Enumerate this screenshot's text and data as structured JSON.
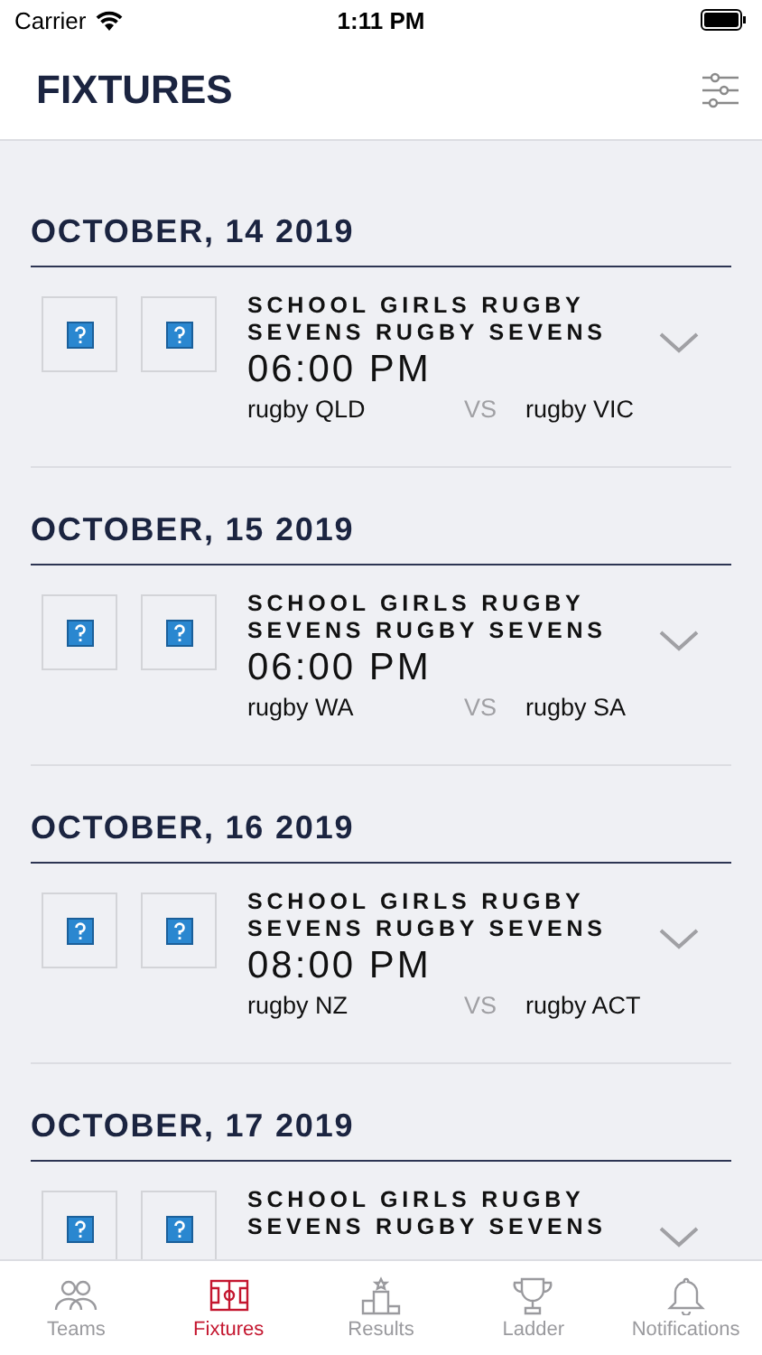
{
  "status_bar": {
    "carrier": "Carrier",
    "time": "1:11 PM"
  },
  "header": {
    "title": "FIXTURES"
  },
  "days": [
    {
      "date": "OCTOBER, 14 2019",
      "fixtures": [
        {
          "competition": "SCHOOL GIRLS RUGBY SEVENS RUGBY SEVENS",
          "time": "06:00 PM",
          "home": "rugby QLD",
          "vs": "VS",
          "away": "rugby VIC"
        }
      ]
    },
    {
      "date": "OCTOBER, 15 2019",
      "fixtures": [
        {
          "competition": "SCHOOL GIRLS RUGBY SEVENS RUGBY SEVENS",
          "time": "06:00 PM",
          "home": "rugby WA",
          "vs": "VS",
          "away": "rugby SA"
        }
      ]
    },
    {
      "date": "OCTOBER, 16 2019",
      "fixtures": [
        {
          "competition": "SCHOOL GIRLS RUGBY SEVENS RUGBY SEVENS",
          "time": "08:00 PM",
          "home": "rugby NZ",
          "vs": "VS",
          "away": "rugby ACT"
        }
      ]
    },
    {
      "date": "OCTOBER, 17 2019",
      "fixtures": [
        {
          "competition": "SCHOOL GIRLS RUGBY SEVENS RUGBY SEVENS"
        }
      ]
    }
  ],
  "tabs": [
    {
      "label": "Teams",
      "kind": "teams",
      "selected": false
    },
    {
      "label": "Fixtures",
      "kind": "fixtures",
      "selected": true
    },
    {
      "label": "Results",
      "kind": "results",
      "selected": false
    },
    {
      "label": "Ladder",
      "kind": "ladder",
      "selected": false
    },
    {
      "label": "Notifications",
      "kind": "notifications",
      "selected": false
    }
  ]
}
